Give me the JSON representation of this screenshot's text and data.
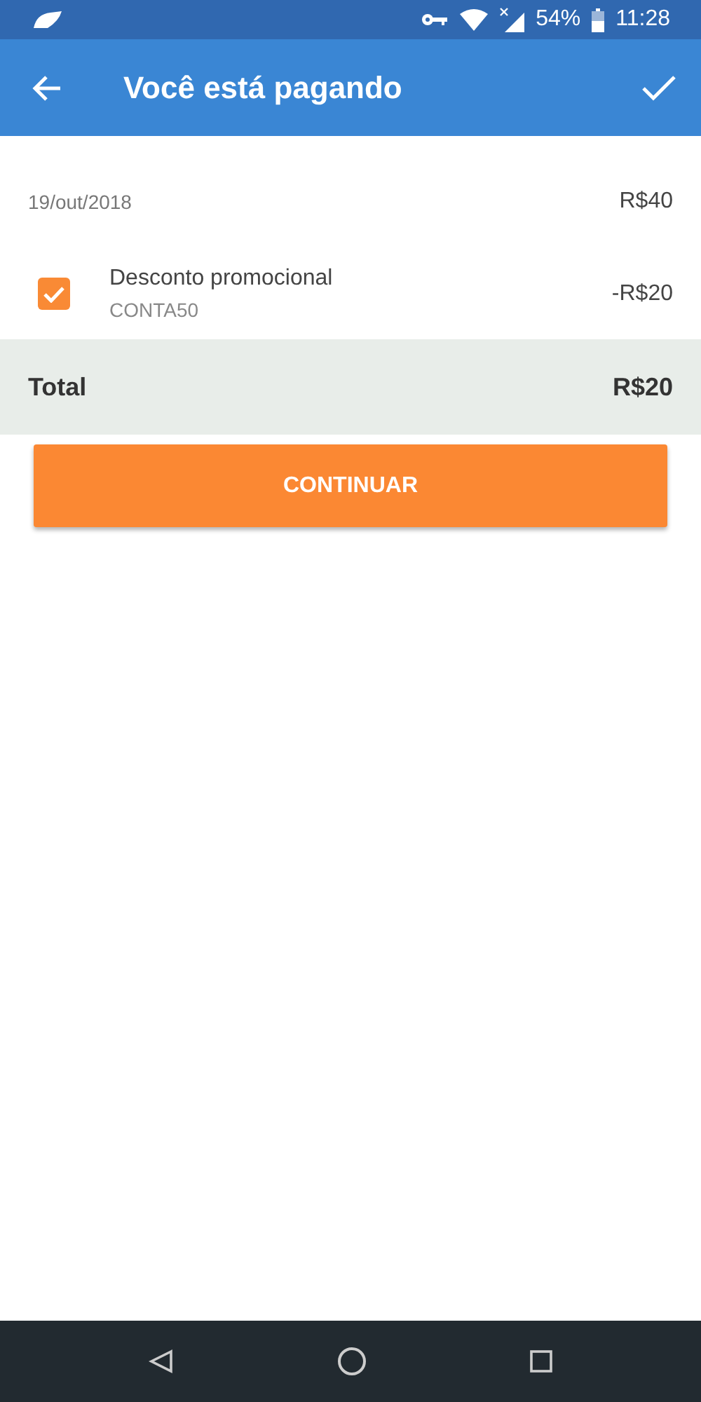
{
  "status_bar": {
    "battery": "54%",
    "time": "11:28"
  },
  "app_bar": {
    "title": "Você está pagando"
  },
  "date_row": {
    "date": "19/out/2018",
    "amount": "R$40"
  },
  "discount": {
    "label": "Desconto promocional",
    "code": "CONTA50",
    "amount": "-R$20",
    "checked": true
  },
  "total": {
    "label": "Total",
    "amount": "R$20"
  },
  "button": {
    "label": "CONTINUAR"
  }
}
